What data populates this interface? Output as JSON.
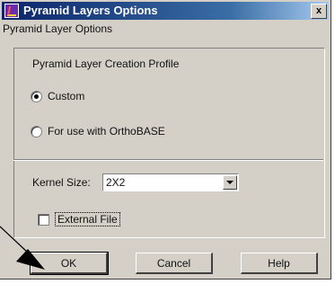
{
  "window": {
    "title": "Pyramid Layers Options",
    "close_glyph": "x",
    "subtitle": "Pyramid Layer Options"
  },
  "profile": {
    "label": "Pyramid Layer Creation Profile",
    "options": [
      {
        "label": "Custom",
        "selected": true
      },
      {
        "label": "For use with OrthoBASE",
        "selected": false
      }
    ]
  },
  "kernel": {
    "label": "Kernel Size:",
    "value": "2X2"
  },
  "external_file": {
    "label": "External File",
    "checked": false
  },
  "buttons": {
    "ok": "OK",
    "cancel": "Cancel",
    "help": "Help"
  },
  "icons": {
    "app": "pyramid-layers-icon",
    "close": "close-icon",
    "dropdown": "chevron-down-icon",
    "pointer": "arrow-pointer-icon"
  },
  "colors": {
    "title_bar_start": "#0a246a",
    "title_bar_end": "#a6caf0",
    "dialog_face": "#d4d0c8"
  }
}
